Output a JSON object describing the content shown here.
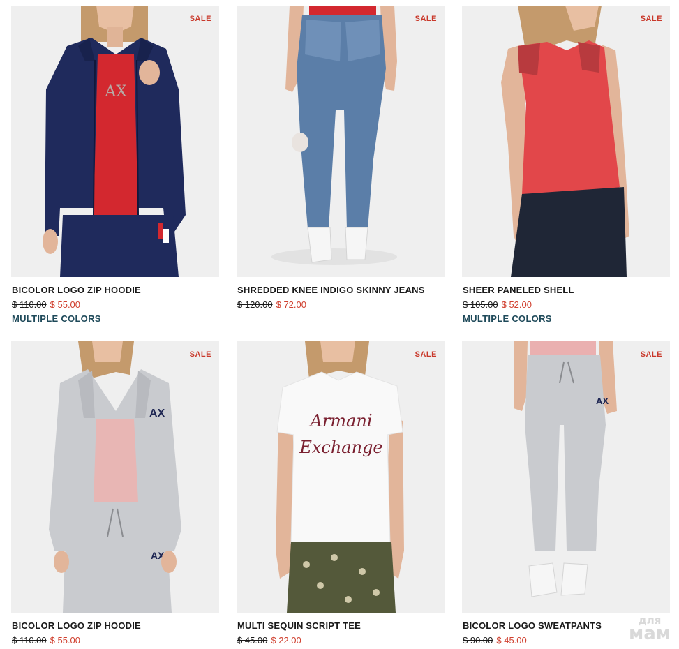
{
  "products": [
    {
      "badge": "SALE",
      "name": "BICOLOR LOGO ZIP HOODIE",
      "old_price": "$ 110.00",
      "new_price": "$ 55.00",
      "colors_link": "MULTIPLE COLORS",
      "image": "woman-navy-zip-hoodie"
    },
    {
      "badge": "SALE",
      "name": "SHREDDED KNEE INDIGO SKINNY JEANS",
      "old_price": "$ 120.00",
      "new_price": "$ 72.00",
      "image": "woman-ripped-skinny-jeans"
    },
    {
      "badge": "SALE",
      "name": "SHEER PANELED SHELL",
      "old_price": "$ 105.00",
      "new_price": "$ 52.00",
      "colors_link": "MULTIPLE COLORS",
      "image": "woman-red-sleeveless-top"
    },
    {
      "badge": "SALE",
      "name": "BICOLOR LOGO ZIP HOODIE",
      "old_price": "$ 110.00",
      "new_price": "$ 55.00",
      "image": "woman-grey-zip-hoodie"
    },
    {
      "badge": "SALE",
      "name": "MULTI SEQUIN SCRIPT TEE",
      "old_price": "$ 45.00",
      "new_price": "$ 22.00",
      "image": "woman-white-script-tee"
    },
    {
      "badge": "SALE",
      "name": "BICOLOR LOGO SWEATPANTS",
      "old_price": "$ 90.00",
      "new_price": "$ 45.00",
      "image": "woman-grey-sweatpants"
    }
  ],
  "tee_print": {
    "line1": "Armani",
    "line2": "Exchange"
  },
  "watermark": {
    "line1": "для",
    "line2": "мам"
  },
  "colors": {
    "sale": "#c9382a",
    "price_new": "#d0402f",
    "colors_link": "#1f4a5a",
    "image_bg": "#efefef"
  }
}
